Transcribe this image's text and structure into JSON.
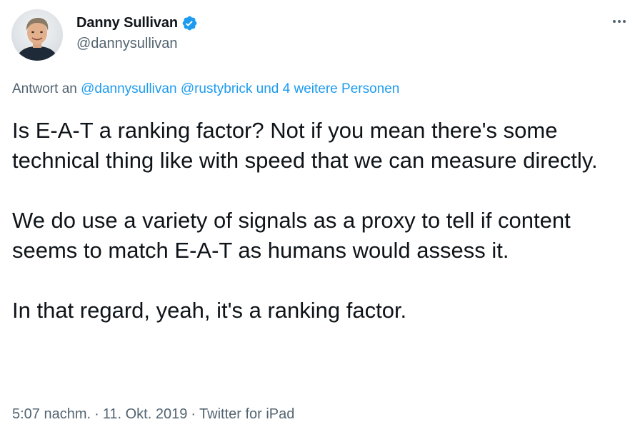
{
  "author": {
    "name": "Danny Sullivan",
    "handle": "@dannysullivan"
  },
  "reply": {
    "prefix": "Antwort an",
    "mention_1": "@dannysullivan",
    "mention_2": "@rustybrick",
    "others": "und 4 weitere Personen"
  },
  "tweet": {
    "paragraphs": [
      "Is E-A-T a ranking factor? Not if you mean there's some technical thing like with speed that we can measure directly.",
      "We do use a variety of signals as a proxy to tell if content seems to match E-A-T as humans would assess it.",
      "In that regard, yeah, it's a ranking factor."
    ]
  },
  "meta": {
    "time": "5:07 nachm.",
    "date": "11. Okt. 2019",
    "source": "Twitter for iPad",
    "separator": "·"
  },
  "colors": {
    "text": "#0f1419",
    "secondary": "#536471",
    "link": "#1d9bf0",
    "verified": "#1d9bf0"
  },
  "icons": {
    "verified": "verified-badge-icon",
    "more": "more-options-icon"
  }
}
